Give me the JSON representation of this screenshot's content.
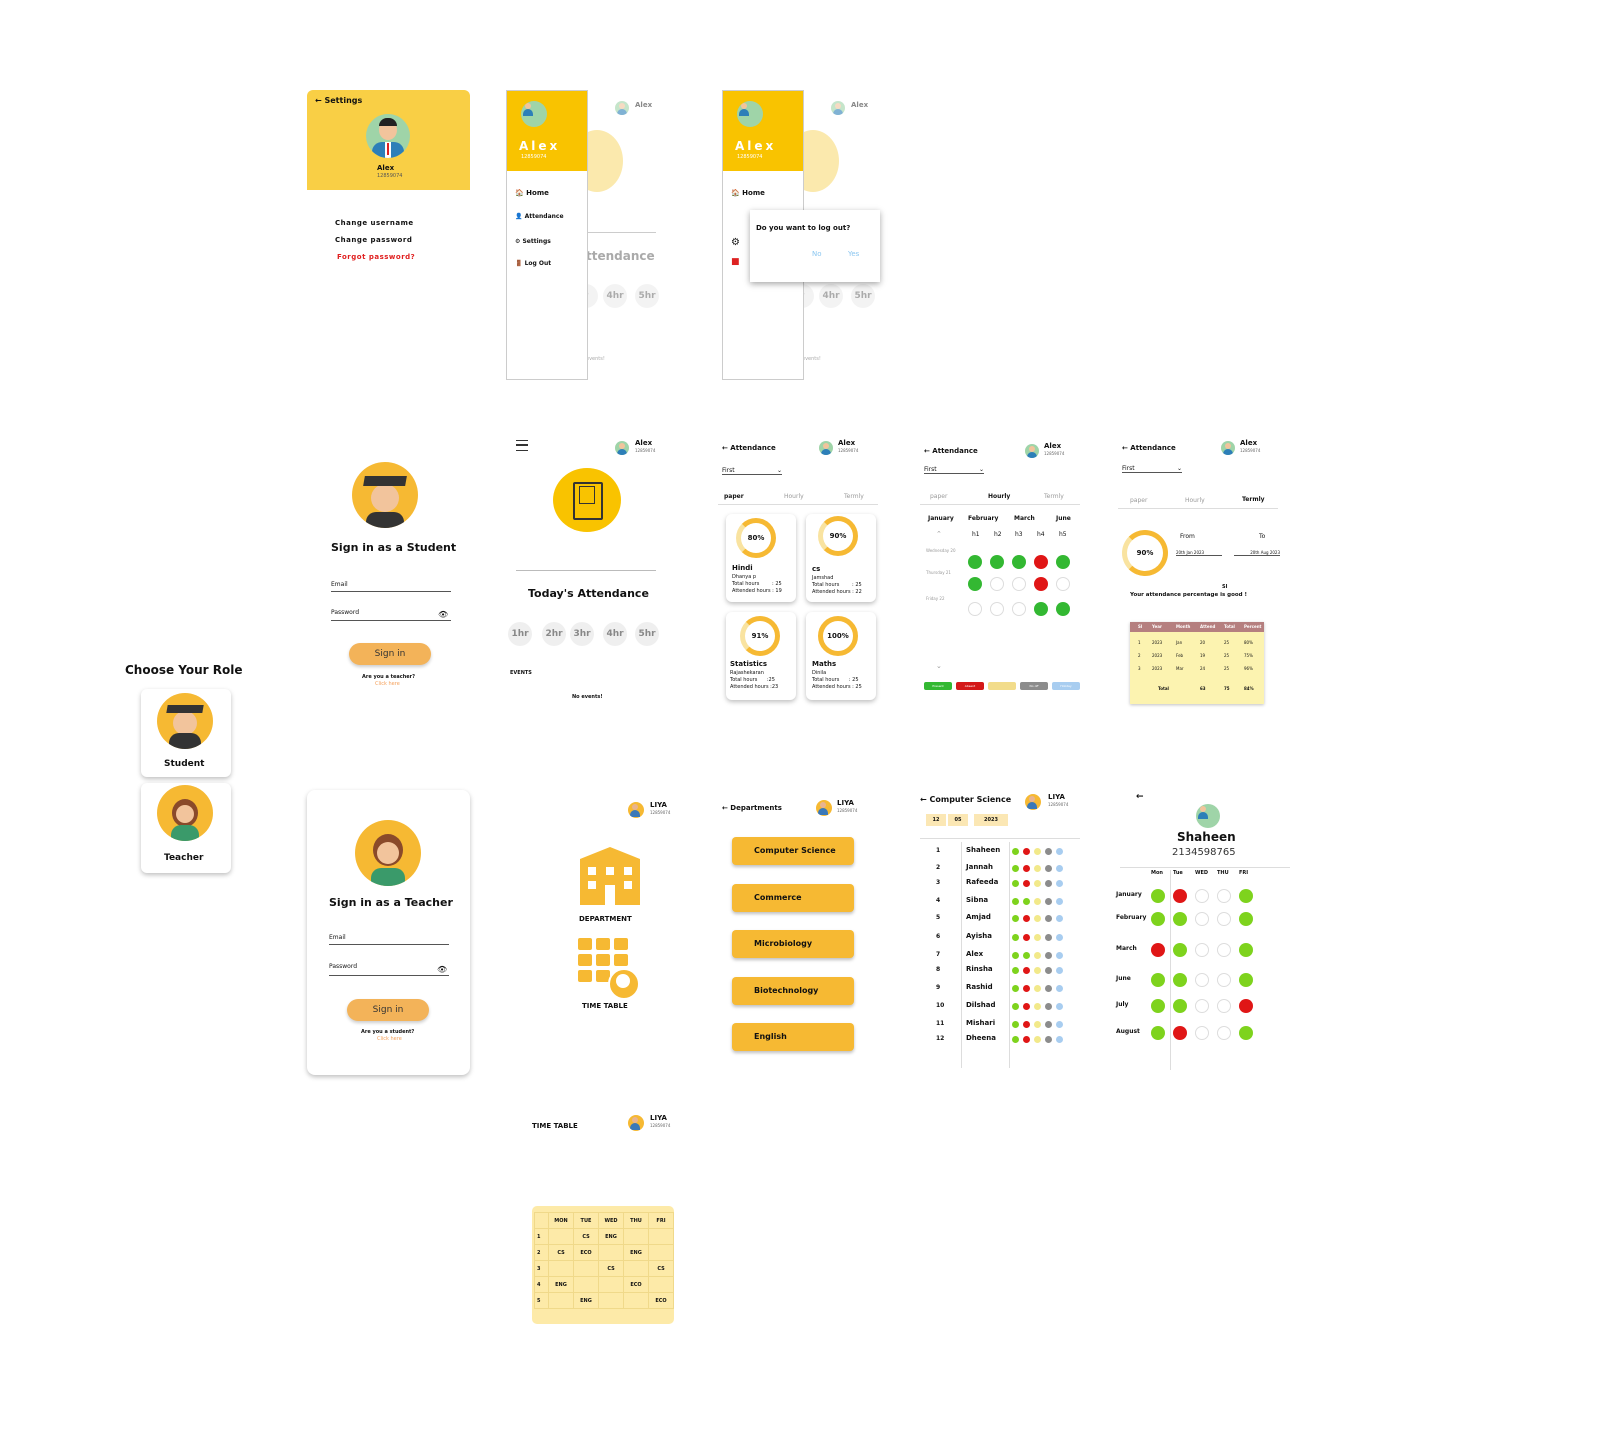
{
  "settings": {
    "back": "← Settings",
    "name": "Alex",
    "id": "12859074",
    "items": [
      "Change username",
      "Change password"
    ],
    "forgot": "Forgot password?"
  },
  "drawer": {
    "name": "Alex",
    "id": "12859074",
    "items": [
      "Home",
      "Attendance",
      "Settings",
      "Log Out"
    ],
    "bg_attendance": "ttendance",
    "bg_hours": [
      "r",
      "4hr",
      "5hr"
    ],
    "bg_events": "events!"
  },
  "logout_drawer": {
    "name": "Alex",
    "id": "12859074",
    "home": "Home"
  },
  "logout_dialog": {
    "question": "Do you want to log out?",
    "no": "No",
    "yes": "Yes"
  },
  "role": {
    "title": "Choose Your Role",
    "student": "Student",
    "teacher": "Teacher"
  },
  "student_signin": {
    "title": "Sign in as a Student",
    "email": "Email",
    "password": "Password",
    "button": "Sign in",
    "question": "Are you a teacher?",
    "link": "Click here"
  },
  "teacher_signin": {
    "title": "Sign in as a Teacher",
    "email": "Email",
    "password": "Password",
    "button": "Sign in",
    "question": "Are you a student?",
    "link": "Click here"
  },
  "home": {
    "user": "Alex",
    "id": "12859074",
    "title": "Today's Attendance",
    "hours": [
      "1hr",
      "2hr",
      "3hr",
      "4hr",
      "5hr"
    ],
    "events_label": "EVENTS",
    "no_events": "No events!"
  },
  "attendance_paper": {
    "title": "← Attendance",
    "select": "First",
    "tabs": [
      "paper",
      "Hourly",
      "Termly"
    ],
    "subjects": [
      {
        "pct": "80%",
        "name": "Hindi",
        "teacher": "Dhanya p",
        "total": "Total hours        : 25",
        "attended": "Attended hours : 19"
      },
      {
        "pct": "90%",
        "name": "cs",
        "teacher": "Jamshad",
        "total": "Total hours        : 25",
        "attended": "Attended hours : 22"
      },
      {
        "pct": "91%",
        "name": "Statistics",
        "teacher": "Rajashekaran",
        "total": "Total hours      :25",
        "attended": "Attended hours :23"
      },
      {
        "pct": "100%",
        "name": "Maths",
        "teacher": "Dinila",
        "total": "Total hours      : 25",
        "attended": "Attended hours : 25"
      }
    ]
  },
  "attendance_hourly": {
    "title": "← Attendance",
    "select": "First",
    "tabs": [
      "paper",
      "Hourly",
      "Termly"
    ],
    "months": [
      "January",
      "February",
      "March",
      "June"
    ],
    "hours": [
      "h1",
      "h2",
      "h3",
      "h4",
      "h5"
    ],
    "days": [
      "Wednesday 20",
      "Thursday 21",
      "Friday 22"
    ],
    "legend": [
      "Present",
      "Absent",
      "",
      "No off",
      "Holiday"
    ]
  },
  "attendance_termly": {
    "title": "← Attendance",
    "select": "First",
    "tabs": [
      "paper",
      "Hourly",
      "Termly"
    ],
    "pct": "90%",
    "from_label": "From",
    "to_label": "To",
    "from": "20th Jan 2023",
    "to": "20th Aug 2023",
    "si": "SI",
    "message": "Your attendance percentage is good !",
    "headers": [
      "Sl",
      "Year",
      "Month",
      "Attend",
      "Total",
      "Percent"
    ],
    "rows": [
      [
        "1",
        "2023",
        "Jan",
        "20",
        "25",
        "80%"
      ],
      [
        "2",
        "2023",
        "Feb",
        "19",
        "25",
        "75%"
      ],
      [
        "3",
        "2023",
        "Mar",
        "24",
        "25",
        "96%"
      ]
    ],
    "total": [
      "Total",
      "63",
      "75",
      "84%"
    ]
  },
  "teacher_home": {
    "user": "LIYA",
    "id": "12859074",
    "department": "DEPARTMENT",
    "timetable": "TIME TABLE"
  },
  "departments": {
    "title": "← Departments",
    "user": "LIYA",
    "id": "12859074",
    "items": [
      "Computer Science",
      "Commerce",
      "Microbiology",
      "Biotechnology",
      "English"
    ]
  },
  "cs_list": {
    "title": "← Computer Science",
    "user": "LIYA",
    "id": "12859074",
    "date": [
      "12",
      "05",
      "2023"
    ],
    "students": [
      "Shaheen",
      "Jannah",
      "Rafeeda",
      "Sibna",
      "Amjad",
      "Ayisha",
      "Alex",
      "Rinsha",
      "Rashid",
      "Dilshad",
      "Mishari",
      "Dheena"
    ]
  },
  "student_detail": {
    "back": "←",
    "name": "Shaheen",
    "phone": "2134598765",
    "days": [
      "Mon",
      "Tue",
      "WED",
      "THU",
      "FRI"
    ],
    "months": [
      "January",
      "February",
      "March",
      "June",
      "July",
      "August"
    ]
  },
  "timetable": {
    "title": "TIME TABLE",
    "user": "LIYA",
    "id": "12859074",
    "headers": [
      "",
      "MON",
      "TUE",
      "WED",
      "THU",
      "FRI"
    ],
    "rows": [
      [
        "1",
        "",
        "CS",
        "ENG",
        "",
        ""
      ],
      [
        "2",
        "CS",
        "ECO",
        "",
        "ENG",
        ""
      ],
      [
        "3",
        "",
        "",
        "CS",
        "",
        "CS"
      ],
      [
        "4",
        "ENG",
        "",
        "",
        "ECO",
        ""
      ],
      [
        "5",
        "",
        "ENG",
        "",
        "",
        "ECO"
      ]
    ]
  },
  "colors": {
    "accent": "#f6b933",
    "present": "#33b832",
    "absent": "#e01616",
    "link": "#e02020"
  }
}
